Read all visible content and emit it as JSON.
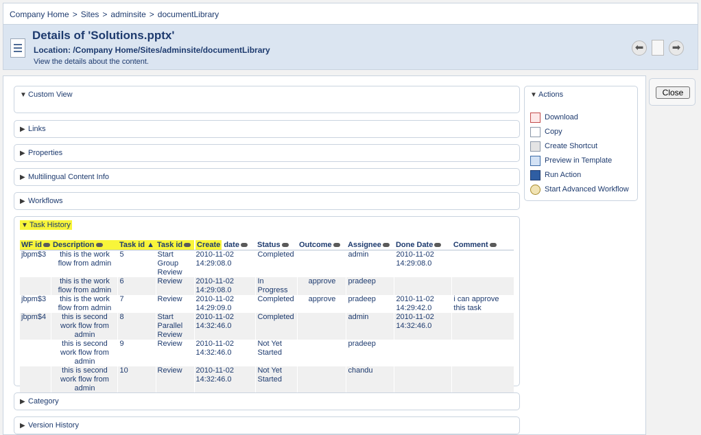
{
  "breadcrumb": [
    "Company Home",
    "Sites",
    "adminsite",
    "documentLibrary"
  ],
  "header": {
    "title": "Details of 'Solutions.pptx'",
    "location": "Location: /Company Home/Sites/adminsite/documentLibrary",
    "description": "View the details about the content."
  },
  "panels": {
    "custom_view": "Custom View",
    "links": "Links",
    "properties": "Properties",
    "multilingual": "Multilingual Content Info",
    "workflows": "Workflows",
    "task_history": "Task History",
    "category": "Category",
    "version_history": "Version History"
  },
  "task_table": {
    "headers": [
      "WF id",
      "Description",
      "Task id",
      "Task id",
      "Create",
      "date",
      "Status",
      "Outcome",
      "Assignee",
      "Done Date",
      "Comment"
    ],
    "rows": [
      {
        "wf": "jbpm$3",
        "desc": "this is the work flow from admin",
        "id": "5",
        "task": "Start Group Review",
        "created": "2010-11-02 14:29:08.0",
        "status": "Completed",
        "outcome": "",
        "assignee": "admin",
        "done": "2010-11-02 14:29:08.0",
        "comment": ""
      },
      {
        "wf": "",
        "desc": "this is the work flow from admin",
        "id": "6",
        "task": "Review",
        "created": "2010-11-02 14:29:08.0",
        "status": "In Progress",
        "outcome": "approve",
        "assignee": "pradeep",
        "done": "",
        "comment": ""
      },
      {
        "wf": "jbpm$3",
        "desc": "this is the work flow from admin",
        "id": "7",
        "task": "Review",
        "created": "2010-11-02 14:29:09.0",
        "status": "Completed",
        "outcome": "approve",
        "assignee": "pradeep",
        "done": "2010-11-02 14:29:42.0",
        "comment": "i can approve this task"
      },
      {
        "wf": "jbpm$4",
        "desc": "this is second work flow from admin",
        "id": "8",
        "task": "Start Parallel Review",
        "created": "2010-11-02 14:32:46.0",
        "status": "Completed",
        "outcome": "",
        "assignee": "admin",
        "done": "2010-11-02 14:32:46.0",
        "comment": ""
      },
      {
        "wf": "",
        "desc": "this is second work flow from admin",
        "id": "9",
        "task": "Review",
        "created": "2010-11-02 14:32:46.0",
        "status": "Not Yet Started",
        "outcome": "",
        "assignee": "pradeep",
        "done": "",
        "comment": ""
      },
      {
        "wf": "",
        "desc": "this is second work flow from admin",
        "id": "10",
        "task": "Review",
        "created": "2010-11-02 14:32:46.0",
        "status": "Not Yet Started",
        "outcome": "",
        "assignee": "chandu",
        "done": "",
        "comment": ""
      }
    ]
  },
  "actions": {
    "title": "Actions",
    "items": [
      {
        "label": "Download",
        "icon": "download-icon"
      },
      {
        "label": "Copy",
        "icon": "copy-icon"
      },
      {
        "label": "Create Shortcut",
        "icon": "shortcut-icon"
      },
      {
        "label": "Preview in Template",
        "icon": "preview-icon"
      },
      {
        "label": "Run Action",
        "icon": "run-action-icon"
      },
      {
        "label": "Start Advanced Workflow",
        "icon": "workflow-gear-icon"
      }
    ]
  },
  "close_label": "Close",
  "colors": {
    "highlight": "#f8f53a",
    "header_bg": "#dbe5f1",
    "link_text": "#1d3a6e"
  }
}
